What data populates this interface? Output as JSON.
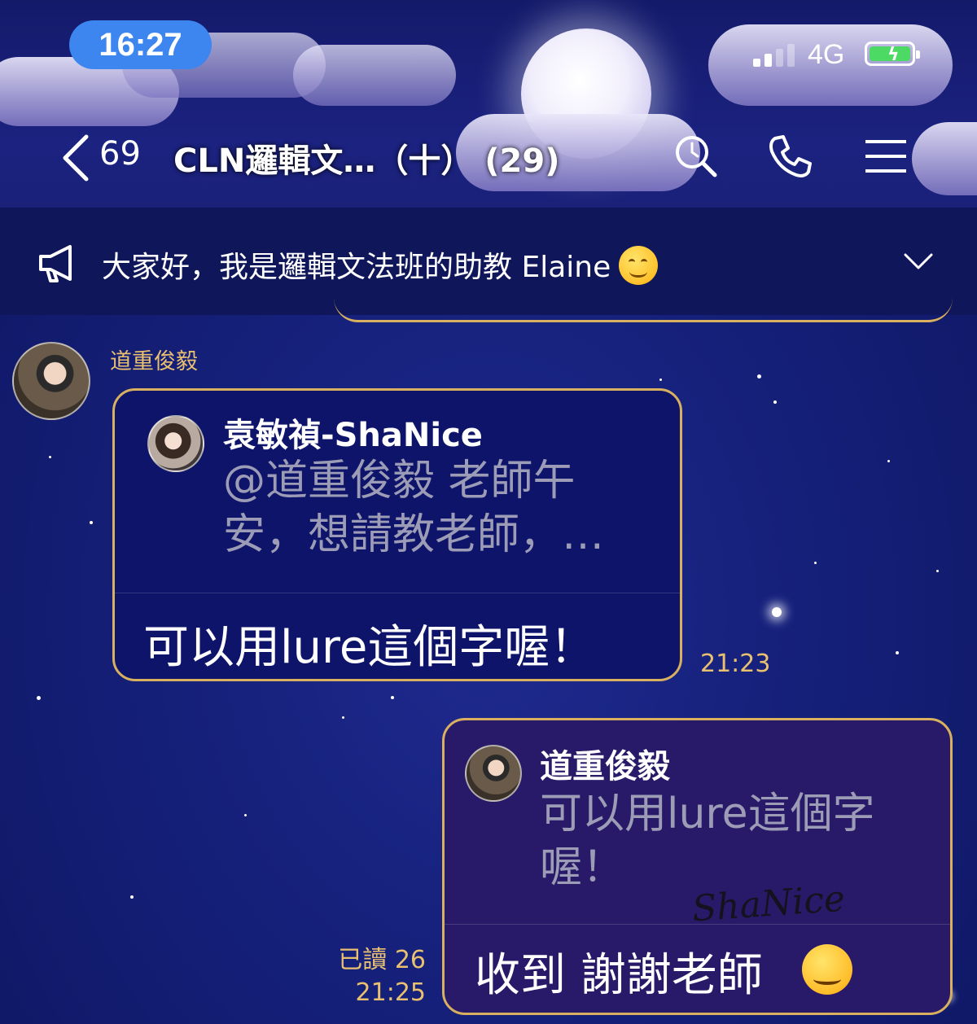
{
  "status_bar": {
    "time": "16:27",
    "network": "4G"
  },
  "header": {
    "unread_count": "69",
    "title": "CLN邏輯文…（十） (29)"
  },
  "announcement": {
    "text": "大家好，我是邏輯文法班的助教 Elaine"
  },
  "messages": [
    {
      "sender": "道重俊毅",
      "quote_name": "袁敏禎-ShaNice",
      "quote_text": "@道重俊毅 老師午安，想請教老師，…",
      "text": "可以用lure這個字喔！",
      "time": "21:23"
    },
    {
      "quote_name": "道重俊毅",
      "quote_text": "可以用lure這個字喔！",
      "text": "收到 謝謝老師",
      "read_status": "已讀 26",
      "time": "21:25"
    }
  ],
  "watermark": "ShaNice"
}
